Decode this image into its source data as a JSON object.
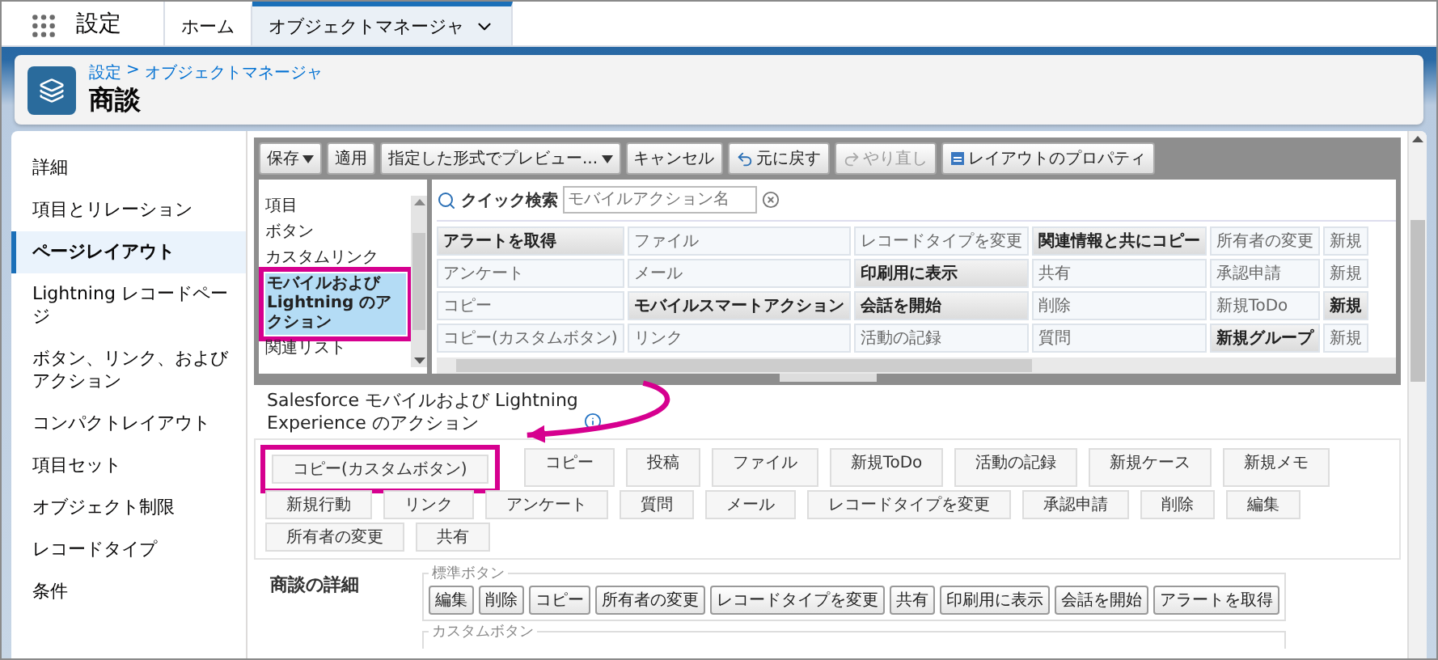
{
  "nav": {
    "app_title": "設定",
    "tabs": [
      {
        "label": "ホーム",
        "selected": false
      },
      {
        "label": "オブジェクトマネージャ",
        "selected": true
      }
    ]
  },
  "header": {
    "breadcrumb": [
      "設定",
      "オブジェクトマネージャ"
    ],
    "separator": ">",
    "title": "商談"
  },
  "sidebar": {
    "items": [
      {
        "label": "詳細",
        "selected": false
      },
      {
        "label": "項目とリレーション",
        "selected": false
      },
      {
        "label": "ページレイアウト",
        "selected": true
      },
      {
        "label": "Lightning レコードページ",
        "selected": false
      },
      {
        "label": "ボタン、リンク、およびアクション",
        "selected": false
      },
      {
        "label": "コンパクトレイアウト",
        "selected": false
      },
      {
        "label": "項目セット",
        "selected": false
      },
      {
        "label": "オブジェクト制限",
        "selected": false
      },
      {
        "label": "レコードタイプ",
        "selected": false
      },
      {
        "label": "条件",
        "selected": false
      }
    ]
  },
  "toolbar": {
    "buttons": [
      {
        "label": "保存",
        "dropdown": true,
        "disabled": false,
        "kind": "plain"
      },
      {
        "label": "適用",
        "dropdown": false,
        "disabled": false,
        "kind": "plain"
      },
      {
        "label": "指定した形式でプレビュー...",
        "dropdown": true,
        "disabled": false,
        "kind": "plain"
      },
      {
        "label": "キャンセル",
        "dropdown": false,
        "disabled": false,
        "kind": "plain"
      },
      {
        "label": "元に戻す",
        "dropdown": false,
        "disabled": false,
        "kind": "undo"
      },
      {
        "label": "やり直し",
        "dropdown": false,
        "disabled": true,
        "kind": "redo"
      },
      {
        "label": "レイアウトのプロパティ",
        "dropdown": false,
        "disabled": false,
        "kind": "properties"
      }
    ]
  },
  "palette": {
    "categories": [
      {
        "label": "項目",
        "selected": false,
        "highlighted": false
      },
      {
        "label": "ボタン",
        "selected": false,
        "highlighted": false
      },
      {
        "label": "カスタムリンク",
        "selected": false,
        "highlighted": false
      },
      {
        "label": "モバイルおよび Lightning のアクション",
        "selected": true,
        "highlighted": true
      },
      {
        "label": "関連リスト",
        "selected": false,
        "highlighted": false
      }
    ],
    "search": {
      "label": "クイック検索",
      "placeholder": "モバイルアクション名"
    },
    "rows": [
      [
        {
          "label": "アラートを取得",
          "placed": false
        },
        {
          "label": "ファイル",
          "placed": true
        },
        {
          "label": "レコードタイプを変更",
          "placed": true
        },
        {
          "label": "関連情報と共にコピー",
          "placed": false
        },
        {
          "label": "所有者の変更",
          "placed": true
        },
        {
          "label": "新規",
          "placed": true
        }
      ],
      [
        {
          "label": "アンケート",
          "placed": true
        },
        {
          "label": "メール",
          "placed": true
        },
        {
          "label": "印刷用に表示",
          "placed": false
        },
        {
          "label": "共有",
          "placed": true
        },
        {
          "label": "承認申請",
          "placed": true
        },
        {
          "label": "新規",
          "placed": true
        }
      ],
      [
        {
          "label": "コピー",
          "placed": true
        },
        {
          "label": "モバイルスマートアクション",
          "placed": false
        },
        {
          "label": "会話を開始",
          "placed": false
        },
        {
          "label": "削除",
          "placed": true
        },
        {
          "label": "新規ToDo",
          "placed": true
        },
        {
          "label": "新規",
          "placed": false
        }
      ],
      [
        {
          "label": "コピー(カスタムボタン)",
          "placed": true
        },
        {
          "label": "リンク",
          "placed": true
        },
        {
          "label": "活動の記録",
          "placed": true
        },
        {
          "label": "質問",
          "placed": true
        },
        {
          "label": "新規グループ",
          "placed": false
        },
        {
          "label": "新規",
          "placed": true
        }
      ]
    ]
  },
  "layout": {
    "actions_title": "Salesforce モバイルおよび Lightning Experience のアクション",
    "actions": [
      {
        "label": "コピー(カスタムボタン)",
        "highlighted": true
      },
      {
        "label": "コピー",
        "highlighted": false
      },
      {
        "label": "投稿",
        "highlighted": false
      },
      {
        "label": "ファイル",
        "highlighted": false
      },
      {
        "label": "新規ToDo",
        "highlighted": false
      },
      {
        "label": "活動の記録",
        "highlighted": false
      },
      {
        "label": "新規ケース",
        "highlighted": false
      },
      {
        "label": "新規メモ",
        "highlighted": false
      },
      {
        "label": "新規行動",
        "highlighted": false
      },
      {
        "label": "リンク",
        "highlighted": false
      },
      {
        "label": "アンケート",
        "highlighted": false
      },
      {
        "label": "質問",
        "highlighted": false
      },
      {
        "label": "メール",
        "highlighted": false
      },
      {
        "label": "レコードタイプを変更",
        "highlighted": false
      },
      {
        "label": "承認申請",
        "highlighted": false
      },
      {
        "label": "削除",
        "highlighted": false
      },
      {
        "label": "編集",
        "highlighted": false
      },
      {
        "label": "所有者の変更",
        "highlighted": false
      },
      {
        "label": "共有",
        "highlighted": false
      }
    ],
    "details_title": "商談の詳細",
    "standard_buttons": {
      "legend": "標準ボタン",
      "buttons": [
        "編集",
        "削除",
        "コピー",
        "所有者の変更",
        "レコードタイプを変更",
        "共有",
        "印刷用に表示",
        "会話を開始",
        "アラートを取得"
      ]
    },
    "custom_buttons": {
      "legend": "カスタムボタン"
    }
  }
}
